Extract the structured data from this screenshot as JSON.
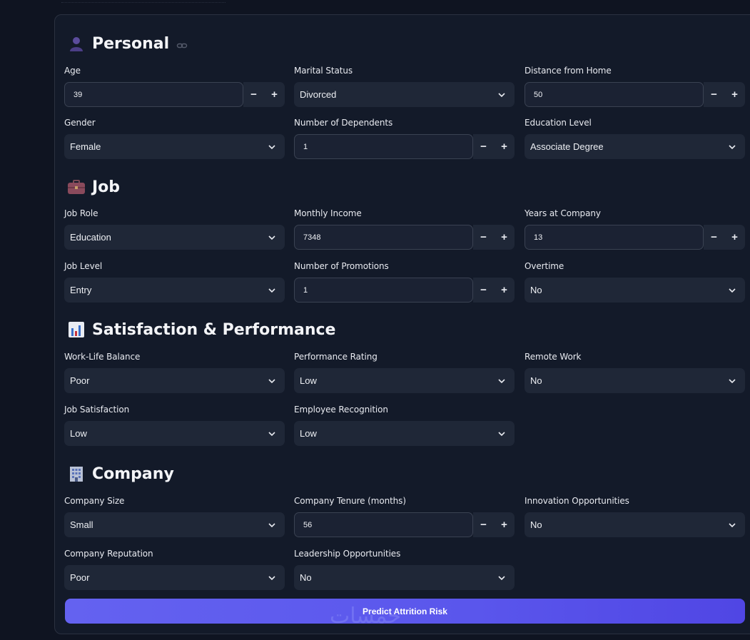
{
  "sections": {
    "personal": {
      "title": "Personal",
      "fields": {
        "age": {
          "label": "Age",
          "value": "39"
        },
        "marital_status": {
          "label": "Marital Status",
          "value": "Divorced"
        },
        "distance": {
          "label": "Distance from Home",
          "value": "50"
        },
        "gender": {
          "label": "Gender",
          "value": "Female"
        },
        "dependents": {
          "label": "Number of Dependents",
          "value": "1"
        },
        "education": {
          "label": "Education Level",
          "value": "Associate Degree"
        }
      }
    },
    "job": {
      "title": "Job",
      "fields": {
        "role": {
          "label": "Job Role",
          "value": "Education"
        },
        "income": {
          "label": "Monthly Income",
          "value": "7348"
        },
        "years": {
          "label": "Years at Company",
          "value": "13"
        },
        "level": {
          "label": "Job Level",
          "value": "Entry"
        },
        "promotions": {
          "label": "Number of Promotions",
          "value": "1"
        },
        "overtime": {
          "label": "Overtime",
          "value": "No"
        }
      }
    },
    "satisfaction": {
      "title": "Satisfaction & Performance",
      "fields": {
        "wlb": {
          "label": "Work-Life Balance",
          "value": "Poor"
        },
        "performance": {
          "label": "Performance Rating",
          "value": "Low"
        },
        "remote": {
          "label": "Remote Work",
          "value": "No"
        },
        "job_sat": {
          "label": "Job Satisfaction",
          "value": "Low"
        },
        "recognition": {
          "label": "Employee Recognition",
          "value": "Low"
        }
      }
    },
    "company": {
      "title": "Company",
      "fields": {
        "size": {
          "label": "Company Size",
          "value": "Small"
        },
        "tenure": {
          "label": "Company Tenure (months)",
          "value": "56"
        },
        "innovation": {
          "label": "Innovation Opportunities",
          "value": "No"
        },
        "reputation": {
          "label": "Company Reputation",
          "value": "Poor"
        },
        "leadership": {
          "label": "Leadership Opportunities",
          "value": "No"
        }
      }
    }
  },
  "stepper": {
    "minus": "−",
    "plus": "+"
  },
  "submit": {
    "label": "Predict Attrition Risk"
  },
  "watermark": "خمسات",
  "icons": {
    "personal": "person-icon",
    "job": "briefcase-icon",
    "satisfaction": "bar-chart-icon",
    "company": "office-building-icon",
    "anchor": "link-icon",
    "select": "chevron-down-icon"
  }
}
